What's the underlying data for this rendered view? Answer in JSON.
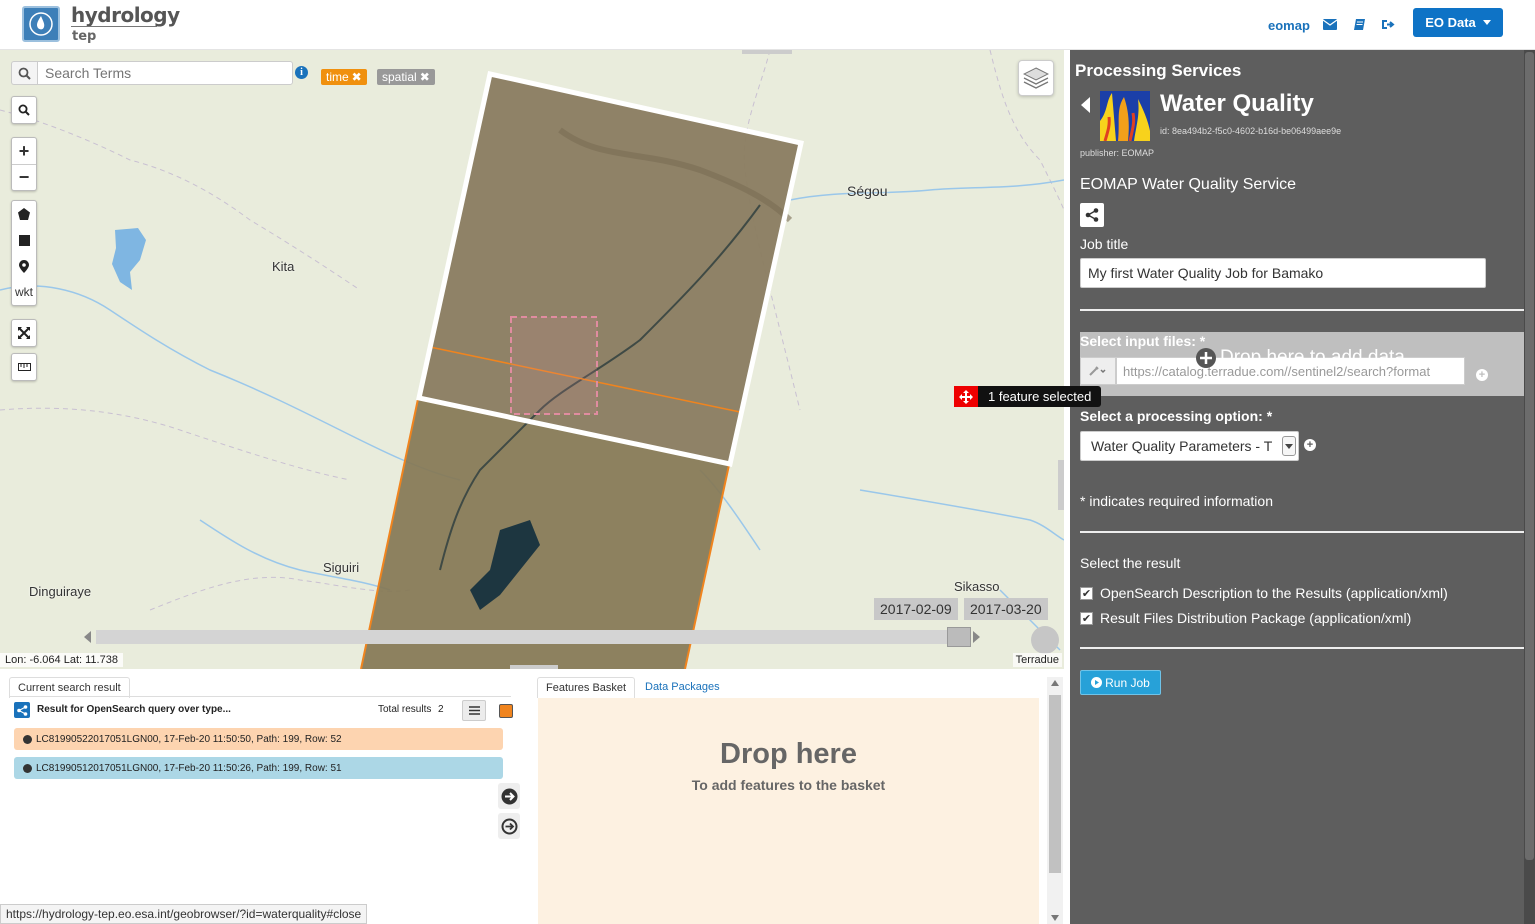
{
  "header": {
    "logo_title": "hydrology",
    "logo_sub": "tep",
    "user_link": "eomap",
    "eo_button": "EO Data"
  },
  "search": {
    "placeholder": "Search Terms",
    "tags": [
      "time",
      "spatial"
    ]
  },
  "map_tools": {
    "wkt_label": "wkt"
  },
  "map": {
    "cities": [
      {
        "name": "Ségou"
      },
      {
        "name": "Kita"
      },
      {
        "name": "Siguiri"
      },
      {
        "name": "Dinguiraye"
      },
      {
        "name": "Sikasso"
      }
    ],
    "feature_selected": "1 feature selected",
    "timeline": {
      "start": "2017-02-09",
      "end": "2017-03-20"
    },
    "coords": "Lon: -6.064 Lat: 11.738",
    "attribution": "Terradue"
  },
  "results": {
    "tab": "Current search result",
    "query": "Result for OpenSearch query over type...",
    "total_label": "Total results",
    "total": "2",
    "items": [
      {
        "text": "LC81990522017051LGN00, 17-Feb-20 11:50:50, Path: 199, Row: 52",
        "color": "#fdd4b0"
      },
      {
        "text": "LC81990512017051LGN00, 17-Feb-20 11:50:26, Path: 199, Row: 51",
        "color": "#acd7e6"
      }
    ]
  },
  "basket": {
    "tab1": "Features Basket",
    "tab2": "Data Packages",
    "title": "Drop here",
    "subtitle": "To add features to the basket"
  },
  "status_url": "https://hydrology-tep.eo.esa.int/geobrowser/?id=waterquality#close",
  "panel": {
    "title": "Processing Services",
    "service": {
      "name": "Water Quality",
      "id": "id: 8ea494b2-f5c0-4602-b16d-be06499aee9e",
      "publisher": "publisher: EOMAP",
      "description": "EOMAP Water Quality Service"
    },
    "job_title_label": "Job title",
    "job_title_value": "My first Water Quality Job for Bamako",
    "input_files_label": "Select input files: *",
    "input_files_value": "https://catalog.terradue.com//sentinel2/search?format",
    "drop_label": "Drop here to add data",
    "processing_label": "Select a processing option: *",
    "processing_value": "Water Quality Parameters - T",
    "required_note": "* indicates required information",
    "result_label": "Select the result",
    "checks": [
      {
        "label": "OpenSearch Description to the Results (application/xml)",
        "checked": true
      },
      {
        "label": "Result Files Distribution Package (application/xml)",
        "checked": true
      }
    ],
    "run_button": "Run Job"
  },
  "colors": {
    "accent": "#0e73c6",
    "panel": "#5e5e5e",
    "time_tag": "#f0900e",
    "spatial_tag": "#999999"
  }
}
